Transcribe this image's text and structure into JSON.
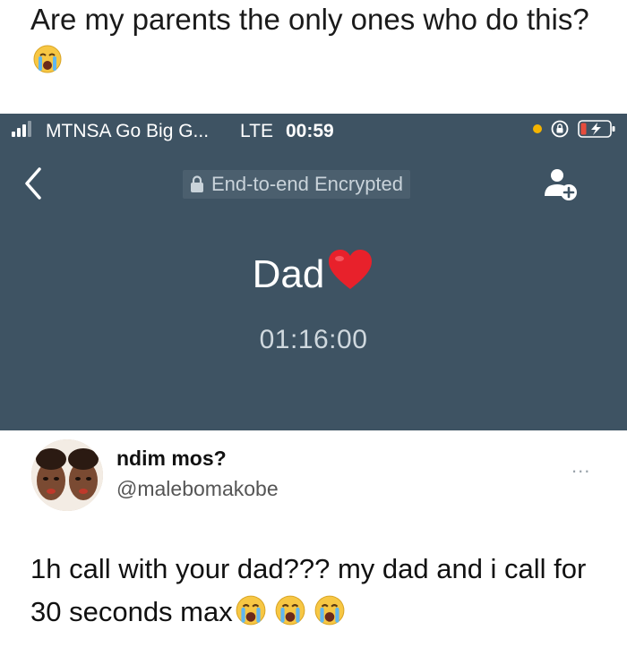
{
  "headline": {
    "text": "Are my parents the only ones who do this?",
    "emoji": "loudly-crying-face"
  },
  "phone_screen": {
    "status_bar": {
      "carrier": "MTNSA Go Big G...",
      "network": "LTE",
      "time": "00:59",
      "icons": [
        "signal-icon",
        "orange-dot-indicator",
        "rotation-lock-icon",
        "battery-charging-icon"
      ]
    },
    "call_header": {
      "back_icon": "chevron-left-icon",
      "encryption_label": "End-to-end Encrypted",
      "add_contact_icon": "add-person-icon"
    },
    "caller_name": "Dad",
    "caller_emoji": "red-heart",
    "call_duration": "01:16:00",
    "colors": {
      "background": "#3e5363",
      "badge": "#4b5f6e"
    }
  },
  "tweet": {
    "display_name": "ndim mos?",
    "handle": "@malebomakobe",
    "more_label": "...",
    "text": "1h call with your dad??? my dad and i call for 30 seconds max",
    "emojis": [
      "loudly-crying-face",
      "loudly-crying-face",
      "loudly-crying-face"
    ]
  }
}
